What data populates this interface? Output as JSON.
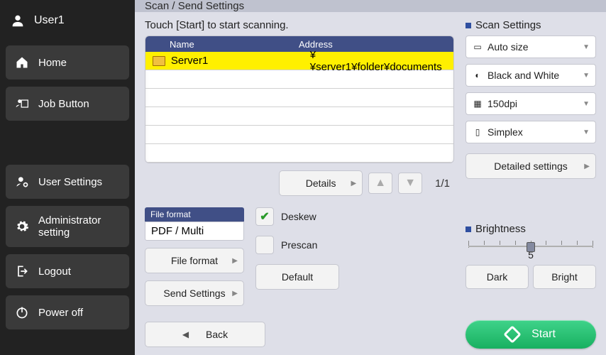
{
  "user": {
    "name": "User1"
  },
  "sidebar": {
    "home": "Home",
    "job_button": "Job Button",
    "user_settings": "User Settings",
    "admin_setting": "Administrator setting",
    "logout": "Logout",
    "power_off": "Power off"
  },
  "title": "Scan / Send Settings",
  "instruction": "Touch [Start] to start scanning.",
  "list": {
    "headers": {
      "name": "Name",
      "address": "Address"
    },
    "rows": [
      {
        "name": "Server1",
        "address": "¥¥server1¥folder¥documents"
      }
    ]
  },
  "details_btn": "Details",
  "page_indicator": "1/1",
  "file_format": {
    "heading": "File format",
    "value": "PDF / Multi",
    "btn": "File format"
  },
  "send_settings_btn": "Send Settings",
  "options": {
    "deskew": "Deskew",
    "prescan": "Prescan",
    "default": "Default"
  },
  "back_btn": "Back",
  "scan_settings": {
    "heading": "Scan Settings",
    "size": "Auto size",
    "color": "Black and White",
    "dpi": "150dpi",
    "duplex": "Simplex",
    "detailed": "Detailed settings"
  },
  "brightness": {
    "heading": "Brightness",
    "value": "5",
    "dark": "Dark",
    "bright": "Bright"
  },
  "start_btn": "Start"
}
